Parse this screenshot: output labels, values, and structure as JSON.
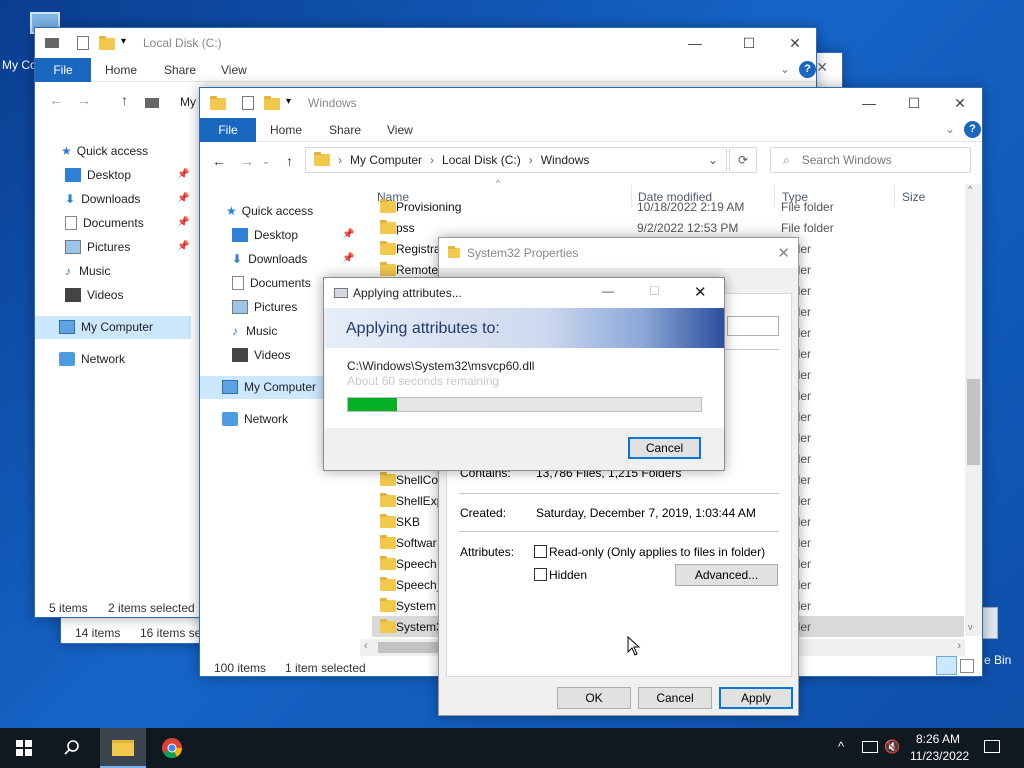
{
  "desktop": {
    "icon1_label": "My Co",
    "icon2_label": "e Bin"
  },
  "back_window": {
    "title": "Local Disk (C:)",
    "ribbon": {
      "file": "File",
      "home": "Home",
      "share": "Share",
      "view": "View"
    },
    "address_partial": "My",
    "nav": [
      {
        "label": "Quick access"
      },
      {
        "label": "Desktop"
      },
      {
        "label": "Downloads"
      },
      {
        "label": "Documents"
      },
      {
        "label": "Pictures"
      },
      {
        "label": "Music"
      },
      {
        "label": "Videos"
      },
      {
        "label": "My Computer"
      },
      {
        "label": "Network"
      }
    ],
    "status_items": "5 items",
    "status_selected": "2 items selected"
  },
  "middle_window": {
    "status_items": "14 items",
    "status_selected": "16 items se"
  },
  "front_window": {
    "title": "Windows",
    "ribbon": {
      "file": "File",
      "home": "Home",
      "share": "Share",
      "view": "View"
    },
    "breadcrumb": [
      "My Computer",
      "Local Disk (C:)",
      "Windows"
    ],
    "search_placeholder": "Search Windows",
    "columns": {
      "name": "Name",
      "date": "Date modified",
      "type": "Type",
      "size": "Size"
    },
    "nav": [
      {
        "label": "Quick access"
      },
      {
        "label": "Desktop"
      },
      {
        "label": "Downloads"
      },
      {
        "label": "Documents"
      },
      {
        "label": "Pictures"
      },
      {
        "label": "Music"
      },
      {
        "label": "Videos"
      },
      {
        "label": "My Computer"
      },
      {
        "label": "Network"
      }
    ],
    "rows": [
      {
        "name": "Provisioning",
        "date": "10/18/2022 2:19 AM",
        "type": "File folder"
      },
      {
        "name": "pss",
        "date": "9/2/2022 12:53 PM",
        "type": "File folder"
      },
      {
        "name": "Registra",
        "date": "",
        "type": "folder"
      },
      {
        "name": "Remote",
        "date": "",
        "type": "folder"
      },
      {
        "name": "",
        "date": "",
        "type": "folder"
      },
      {
        "name": "",
        "date": "",
        "type": "folder"
      },
      {
        "name": "",
        "date": "",
        "type": "folder"
      },
      {
        "name": "",
        "date": "",
        "type": "folder"
      },
      {
        "name": "",
        "date": "",
        "type": "folder"
      },
      {
        "name": "",
        "date": "",
        "type": "folder"
      },
      {
        "name": "",
        "date": "",
        "type": "folder"
      },
      {
        "name": "",
        "date": "",
        "type": "folder"
      },
      {
        "name": "",
        "date": "",
        "type": "folder"
      },
      {
        "name": "ShellCo",
        "date": "",
        "type": "folder"
      },
      {
        "name": "ShellExp",
        "date": "",
        "type": "folder"
      },
      {
        "name": "SKB",
        "date": "",
        "type": "folder"
      },
      {
        "name": "Softwar",
        "date": "",
        "type": "folder"
      },
      {
        "name": "Speech",
        "date": "",
        "type": "folder"
      },
      {
        "name": "Speech_",
        "date": "",
        "type": "folder"
      },
      {
        "name": "System",
        "date": "",
        "type": "folder"
      },
      {
        "name": "System3",
        "date": "",
        "type": "folder"
      }
    ],
    "status_items": "100 items",
    "status_selected": "1 item selected"
  },
  "properties": {
    "title": "System32 Properties",
    "contains_label": "Contains:",
    "contains_value": "13,786 Files, 1,215 Folders",
    "created_label": "Created:",
    "created_value": "Saturday, December 7, 2019, 1:03:44 AM",
    "attributes_label": "Attributes:",
    "readonly_label": "Read-only (Only applies to files in folder)",
    "hidden_label": "Hidden",
    "advanced": "Advanced...",
    "ok": "OK",
    "cancel": "Cancel",
    "apply": "Apply"
  },
  "applying": {
    "title": "Applying attributes...",
    "banner": "Applying attributes to:",
    "path": "C:\\Windows\\System32\\msvcp60.dll",
    "remaining": "About 60 seconds remaining",
    "progress": 0.14,
    "cancel": "Cancel"
  },
  "taskbar": {
    "time": "8:26 AM",
    "date": "11/23/2022"
  },
  "colors": {
    "accent": "#1a67c0",
    "progress": "#06b025"
  }
}
